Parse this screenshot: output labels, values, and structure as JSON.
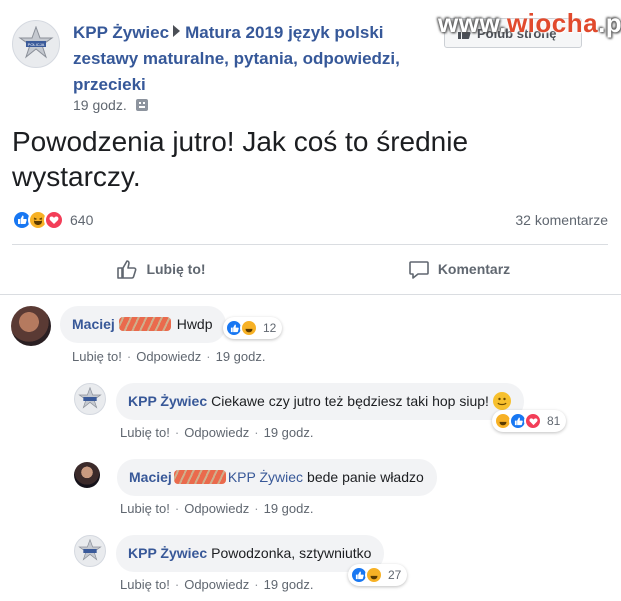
{
  "watermark": {
    "prefix": "www.",
    "brand": "wiocha",
    "suffix": ".pl"
  },
  "page": {
    "name": "KPP Żywiec",
    "group": "Matura 2019 język polski zestawy maturalne, pytania, odpowiedzi, przecieki",
    "time": "19 godz.",
    "like_button": "Polub stronę"
  },
  "post": {
    "text": "Powodzenia jutro! Jak coś to średnie wystarczy.",
    "reaction_count": "640",
    "comments_count": "32 komentarze",
    "like_label": "Lubię to!",
    "comment_label": "Komentarz"
  },
  "comments": [
    {
      "author": "Maciej",
      "text": "Hwdp",
      "reactions": "12",
      "like": "Lubię to!",
      "reply": "Odpowiedz",
      "time": "19 godz."
    },
    {
      "author": "KPP Żywiec",
      "text": "Ciekawe czy jutro też będziesz taki hop siup!",
      "reactions": "81",
      "like": "Lubię to!",
      "reply": "Odpowiedz",
      "time": "19 godz."
    },
    {
      "author": "Maciej",
      "tag": "KPP Żywiec",
      "text": "bede panie władzo",
      "like": "Lubię to!",
      "reply": "Odpowiedz",
      "time": "19 godz."
    },
    {
      "author": "KPP Żywiec",
      "text": "Powodzonka, sztywniutko",
      "reactions": "27",
      "like": "Lubię to!",
      "reply": "Odpowiedz",
      "time": "19 godz."
    }
  ],
  "colors": {
    "link": "#385898",
    "like": "#1877f2",
    "haha": "#f7b125",
    "love": "#f33e58",
    "watermark": "#e14a2d"
  }
}
